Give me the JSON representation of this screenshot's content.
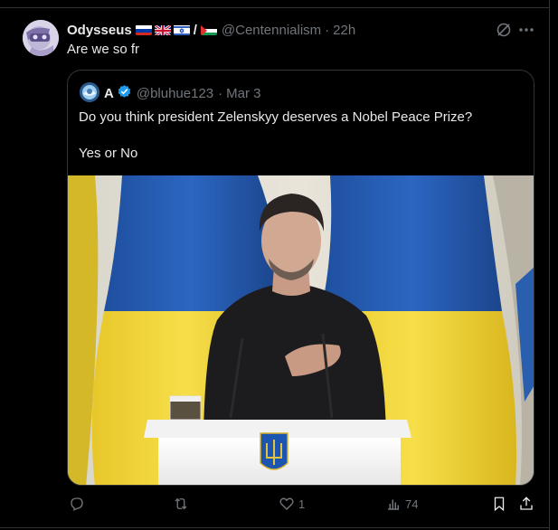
{
  "post": {
    "author": {
      "display_name": "Odysseus",
      "handle": "@Centennialism",
      "time": "22h",
      "flag_separator": "/"
    },
    "text": "Are we so fr"
  },
  "quoted": {
    "author": {
      "display_name": "A",
      "handle": "@bluhue123",
      "date": "Mar 3"
    },
    "lines": [
      "Do you think president Zelenskyy deserves a Nobel Peace Prize?",
      "Yes or No"
    ]
  },
  "actions": {
    "replies": "",
    "reposts": "",
    "likes": "1",
    "views": "74"
  },
  "icons": [
    "grok-icon",
    "more-icon",
    "verified-badge-icon",
    "reply-icon",
    "repost-icon",
    "like-icon",
    "views-icon",
    "bookmark-icon",
    "share-icon"
  ],
  "colors": {
    "background": "#000000",
    "text": "#e7e9ea",
    "muted": "#71767b",
    "border": "#2f3336",
    "verified": "#1d9bf0",
    "flag_blue": "#0057b7",
    "flag_yellow": "#ffd700"
  }
}
